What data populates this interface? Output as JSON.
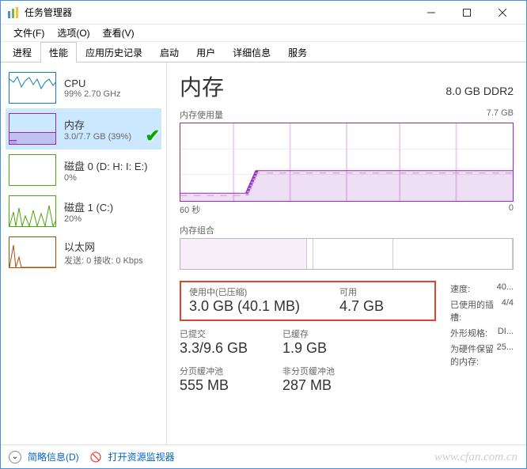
{
  "window": {
    "title": "任务管理器"
  },
  "menu": {
    "file": "文件(F)",
    "options": "选项(O)",
    "view": "查看(V)"
  },
  "tabs": {
    "process": "进程",
    "performance": "性能",
    "history": "应用历史记录",
    "startup": "启动",
    "users": "用户",
    "details": "详细信息",
    "services": "服务"
  },
  "sidebar": {
    "cpu": {
      "title": "CPU",
      "sub": "99% 2.70 GHz"
    },
    "mem": {
      "title": "内存",
      "sub": "3.0/7.7 GB (39%)"
    },
    "disk0": {
      "title": "磁盘 0 (D: H: I: E:)",
      "sub": "0%"
    },
    "disk1": {
      "title": "磁盘 1 (C:)",
      "sub": "20%"
    },
    "net": {
      "title": "以太网",
      "sub": "发送: 0 接收: 0 Kbps"
    }
  },
  "main": {
    "title": "内存",
    "capacity": "8.0 GB DDR2",
    "usage_label": "内存使用量",
    "usage_max": "7.7 GB",
    "time_start": "60 秒",
    "time_end": "0",
    "comp_label": "内存组合"
  },
  "stats": {
    "in_use_label": "使用中(已压缩)",
    "in_use_value": "3.0 GB (40.1 MB)",
    "avail_label": "可用",
    "avail_value": "4.7 GB",
    "committed_label": "已提交",
    "committed_value": "3.3/9.6 GB",
    "cached_label": "已缓存",
    "cached_value": "1.9 GB",
    "paged_label": "分页缓冲池",
    "paged_value": "555 MB",
    "nonpaged_label": "非分页缓冲池",
    "nonpaged_value": "287 MB"
  },
  "info": {
    "speed_label": "速度:",
    "speed_value": "40...",
    "slots_label": "已使用的插槽:",
    "slots_value": "4/4",
    "form_label": "外形规格:",
    "form_value": "DI...",
    "reserved_label": "为硬件保留的内存:",
    "reserved_value": "25..."
  },
  "footer": {
    "brief": "简略信息(D)",
    "monitor": "打开资源监视器"
  },
  "watermark": "www.cfan.com.cn"
}
